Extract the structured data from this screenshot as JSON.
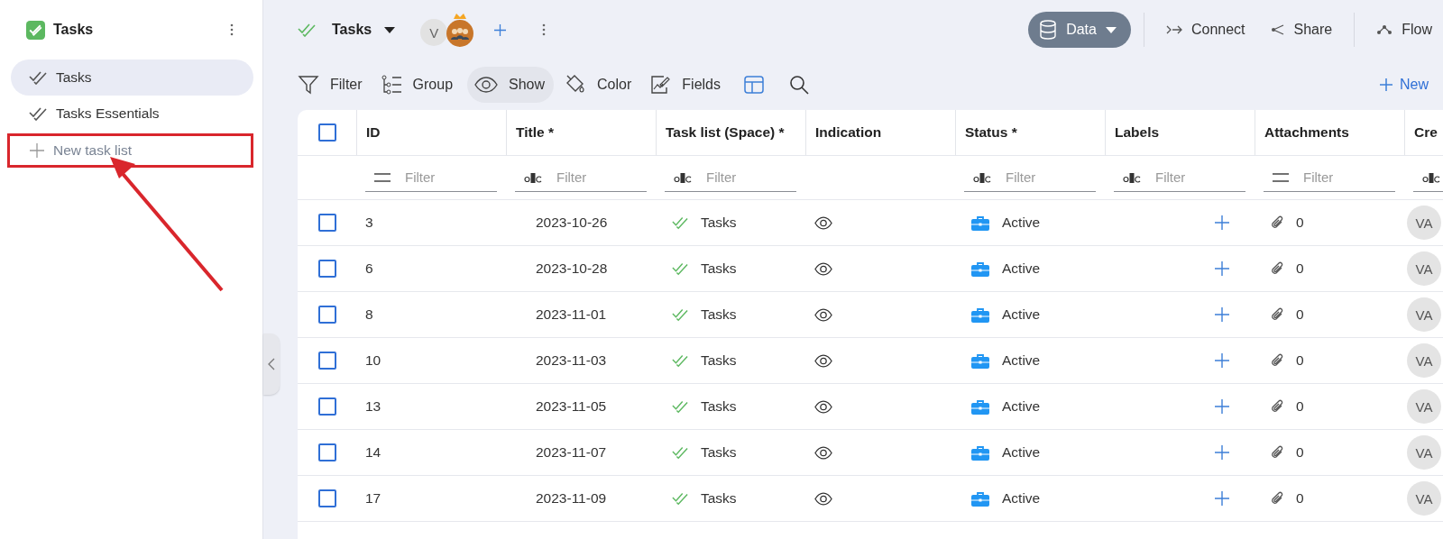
{
  "sidebar": {
    "title": "Tasks",
    "items": [
      {
        "label": "Tasks",
        "selected": true
      },
      {
        "label": "Tasks Essentials",
        "selected": false
      }
    ],
    "new_item": {
      "label": "New task list",
      "highlighted": true
    }
  },
  "topbar": {
    "title": "Tasks",
    "avatar": "V",
    "modes": [
      {
        "label": "Data",
        "kind": "data",
        "selected": true
      },
      {
        "label": "Connect",
        "kind": "connect",
        "selected": false
      },
      {
        "label": "Share",
        "kind": "share",
        "selected": false
      },
      {
        "label": "Flow",
        "kind": "flow",
        "selected": false
      }
    ]
  },
  "toolbar": {
    "items": [
      {
        "label": "Filter",
        "kind": "filter",
        "selected": false
      },
      {
        "label": "Group",
        "kind": "group",
        "selected": false
      },
      {
        "label": "Show",
        "kind": "show",
        "selected": true
      },
      {
        "label": "Color",
        "kind": "color",
        "selected": false
      },
      {
        "label": "Fields",
        "kind": "fields",
        "selected": false
      }
    ],
    "new_label": "New"
  },
  "table": {
    "all_checked": false,
    "columns": [
      {
        "label": "ID",
        "filter": {
          "kind": "list",
          "placeholder": "Filter"
        }
      },
      {
        "label": "Title *",
        "filter": {
          "kind": "text",
          "placeholder": "Filter"
        }
      },
      {
        "label": "Task list (Space) *",
        "filter": {
          "kind": "text",
          "placeholder": "Filter"
        }
      },
      {
        "label": "Indication"
      },
      {
        "label": "Status *",
        "filter": {
          "kind": "text",
          "placeholder": "Filter"
        }
      },
      {
        "label": "Labels",
        "filter": {
          "kind": "text",
          "placeholder": "Filter"
        }
      },
      {
        "label": "Attachments",
        "filter": {
          "kind": "list",
          "placeholder": "Filter"
        }
      },
      {
        "label": "Cre",
        "filter": {
          "kind": "text"
        }
      }
    ],
    "rows": [
      {
        "checked": false,
        "id": "3",
        "title": "2023-10-26",
        "task_list": "Tasks",
        "status": "Active",
        "attachments": "0",
        "creator": "VA"
      },
      {
        "checked": false,
        "id": "6",
        "title": "2023-10-28",
        "task_list": "Tasks",
        "status": "Active",
        "attachments": "0",
        "creator": "VA"
      },
      {
        "checked": false,
        "id": "8",
        "title": "2023-11-01",
        "task_list": "Tasks",
        "status": "Active",
        "attachments": "0",
        "creator": "VA"
      },
      {
        "checked": false,
        "id": "10",
        "title": "2023-11-03",
        "task_list": "Tasks",
        "status": "Active",
        "attachments": "0",
        "creator": "VA"
      },
      {
        "checked": false,
        "id": "13",
        "title": "2023-11-05",
        "task_list": "Tasks",
        "status": "Active",
        "attachments": "0",
        "creator": "VA"
      },
      {
        "checked": false,
        "id": "14",
        "title": "2023-11-07",
        "task_list": "Tasks",
        "status": "Active",
        "attachments": "0",
        "creator": "VA"
      },
      {
        "checked": false,
        "id": "17",
        "title": "2023-11-09",
        "task_list": "Tasks",
        "status": "Active",
        "attachments": "0",
        "creator": "VA"
      }
    ]
  }
}
